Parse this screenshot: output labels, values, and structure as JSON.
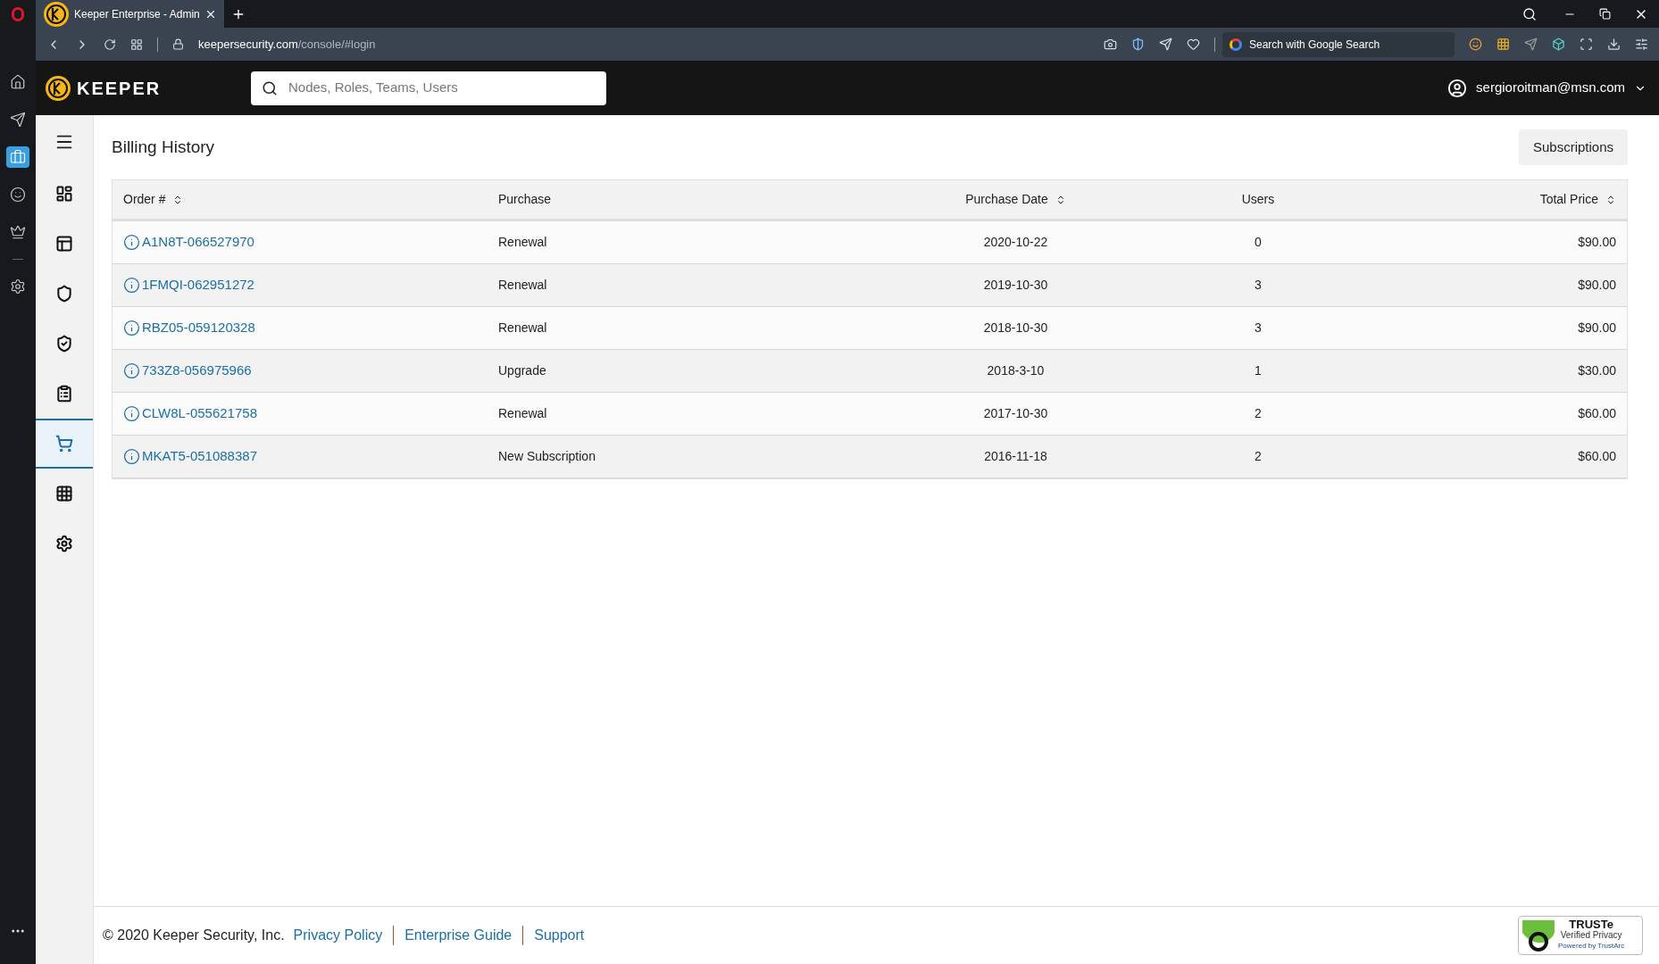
{
  "browser": {
    "tab_title": "Keeper Enterprise - Admin",
    "url_domain": "keepersecurity.com",
    "url_path": "/console/#login",
    "search_placeholder": "Search with Google Search"
  },
  "opera_sidebar": [
    {
      "kind": "home",
      "selected": false
    },
    {
      "kind": "plane",
      "selected": false
    },
    {
      "kind": "briefcase",
      "selected": true
    },
    {
      "kind": "smile",
      "selected": false
    },
    {
      "kind": "crown",
      "selected": false
    },
    {
      "kind": "settings",
      "selected": false
    }
  ],
  "header": {
    "logo": "KEEPER",
    "search_placeholder": "Nodes, Roles, Teams, Users",
    "user": "sergioroitman@msn.com"
  },
  "sidebar": {
    "items": [
      {
        "kind": "dashboard",
        "selected": false
      },
      {
        "kind": "layout",
        "selected": false
      },
      {
        "kind": "shield",
        "selected": false
      },
      {
        "kind": "shield-check",
        "selected": false
      },
      {
        "kind": "clipboard",
        "selected": false
      },
      {
        "kind": "cart",
        "selected": true
      },
      {
        "kind": "apps",
        "selected": false
      },
      {
        "kind": "settings",
        "selected": false
      }
    ]
  },
  "page": {
    "title": "Billing History",
    "button": "Subscriptions"
  },
  "table": {
    "columns": [
      {
        "label": "Order #",
        "sortable": true
      },
      {
        "label": "Purchase",
        "sortable": false
      },
      {
        "label": "Purchase Date",
        "sortable": true
      },
      {
        "label": "Users",
        "sortable": false
      },
      {
        "label": "Total Price",
        "sortable": true
      }
    ],
    "rows": [
      [
        "A1N8T-066527970",
        "Renewal",
        "2020-10-22",
        "0",
        "$90.00"
      ],
      [
        "1FMQI-062951272",
        "Renewal",
        "2019-10-30",
        "3",
        "$90.00"
      ],
      [
        "RBZ05-059120328",
        "Renewal",
        "2018-10-30",
        "3",
        "$90.00"
      ],
      [
        "733Z8-056975966",
        "Upgrade",
        "2018-3-10",
        "1",
        "$30.00"
      ],
      [
        "CLW8L-055621758",
        "Renewal",
        "2017-10-30",
        "2",
        "$60.00"
      ],
      [
        "MKAT5-051088387",
        "New Subscription",
        "2016-11-18",
        "2",
        "$60.00"
      ]
    ]
  },
  "footer": {
    "copyright": "© 2020 Keeper Security, Inc.",
    "links": [
      "Privacy Policy",
      "Enterprise Guide",
      "Support"
    ],
    "badge": {
      "title": "TRUSTe",
      "subtitle": "Verified Privacy",
      "powered": "Powered by TrustArc"
    }
  }
}
